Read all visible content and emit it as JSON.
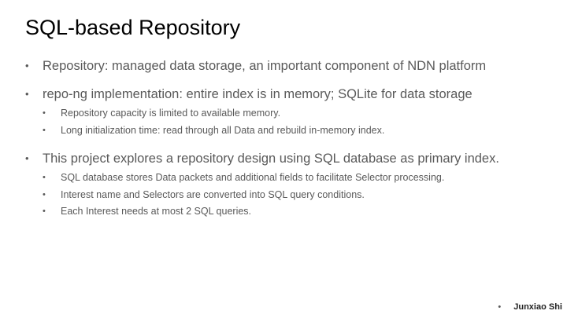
{
  "slide": {
    "title": "SQL-based Repository",
    "bullet_glyph": "•",
    "bullets": [
      {
        "text": "Repository: managed data storage, an important component of NDN platform",
        "sub": []
      },
      {
        "text": "repo-ng implementation: entire index is in memory; SQLite for data storage",
        "sub": [
          "Repository capacity is limited to available memory.",
          "Long initialization time: read through all Data and rebuild in-memory index."
        ]
      },
      {
        "text": "This project explores a repository design using SQL database as primary index.",
        "sub": [
          "SQL database stores Data packets and additional fields to facilitate Selector processing.",
          "Interest name and Selectors are converted into SQL query conditions.",
          "Each Interest needs at most 2 SQL queries."
        ]
      }
    ],
    "footer": {
      "author": "Junxiao Shi"
    }
  }
}
